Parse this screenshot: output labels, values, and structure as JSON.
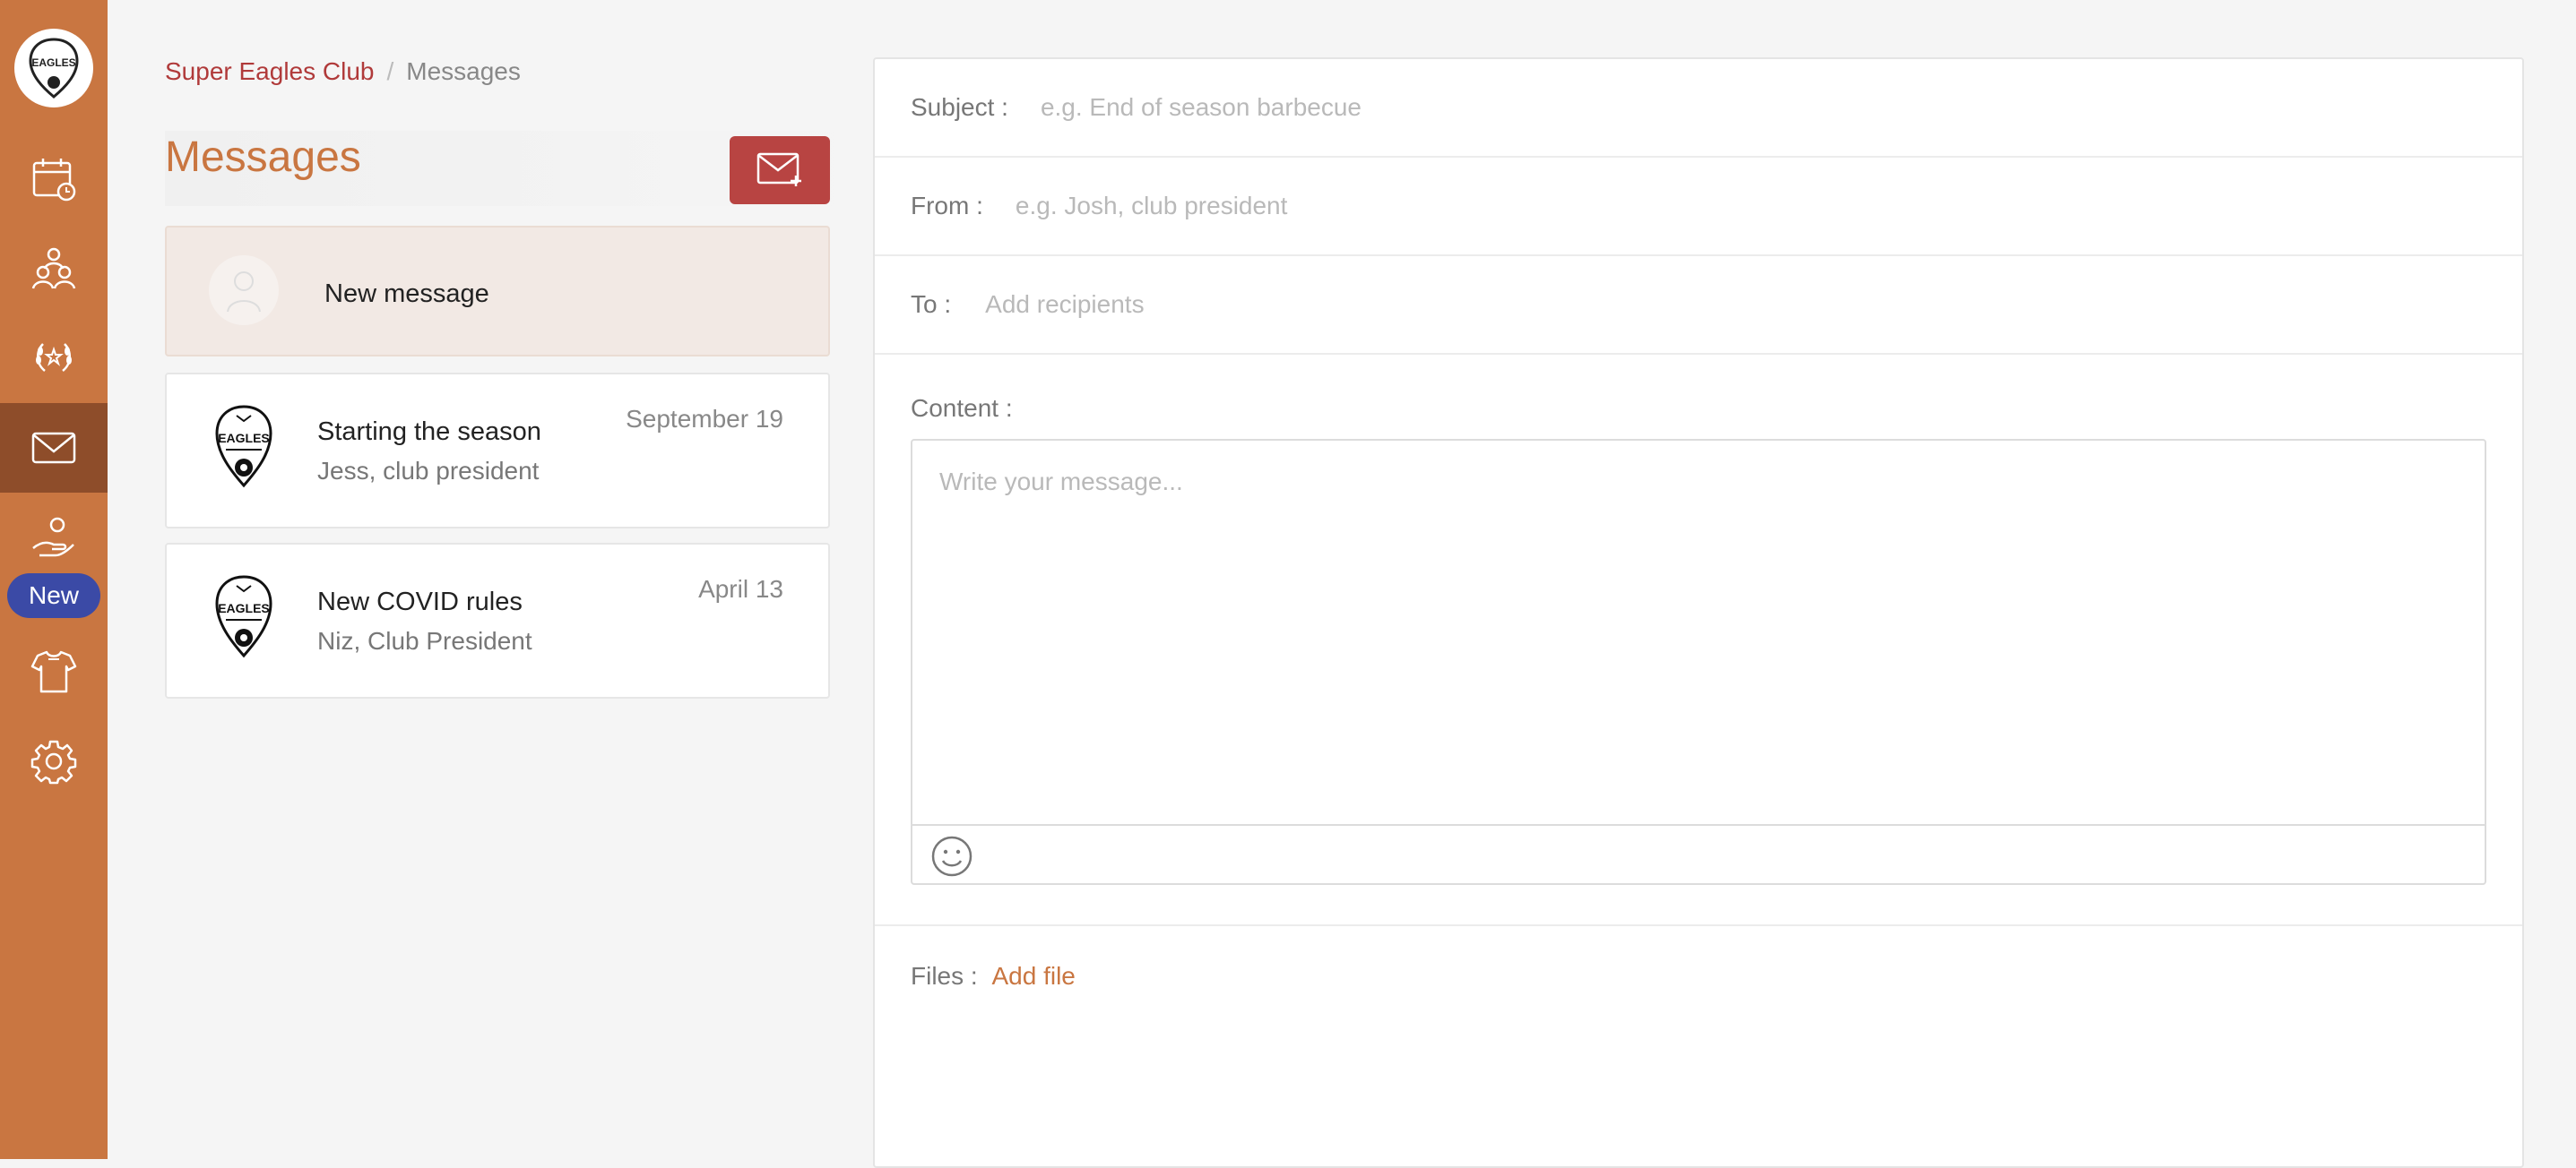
{
  "sidebar": {
    "logo_icon": "club-crest-logo",
    "new_badge": "New",
    "items": [
      {
        "name": "calendar-icon",
        "active": false
      },
      {
        "name": "members-icon",
        "active": false
      },
      {
        "name": "laurel-trophy-icon",
        "active": false
      },
      {
        "name": "envelope-icon",
        "active": true
      },
      {
        "name": "hand-donation-icon",
        "active": false
      },
      {
        "name": "jersey-icon",
        "active": false
      },
      {
        "name": "gear-icon",
        "active": false
      }
    ]
  },
  "breadcrumb": {
    "club": "Super Eagles Club",
    "separator": "/",
    "current": "Messages"
  },
  "page": {
    "title": "Messages",
    "compose_icon": "envelope-plus-icon"
  },
  "messages": [
    {
      "subject": "New message",
      "sender": "",
      "date": "",
      "selected": true,
      "avatar": "placeholder-person-icon"
    },
    {
      "subject": "Starting the season",
      "sender": "Jess, club president",
      "date": "September 19",
      "selected": false,
      "avatar": "club-crest-icon"
    },
    {
      "subject": "New COVID rules",
      "sender": "Niz, Club President",
      "date": "April 13",
      "selected": false,
      "avatar": "club-crest-icon"
    }
  ],
  "form": {
    "subject_label": "Subject :",
    "subject_placeholder": "e.g. End of season barbecue",
    "from_label": "From :",
    "from_placeholder": "e.g. Josh, club president",
    "to_label": "To :",
    "to_placeholder": "Add recipients",
    "content_label": "Content :",
    "content_placeholder": "Write your message...",
    "emoji_icon": "smiley-icon",
    "files_label": "Files :",
    "add_file": "Add file"
  },
  "colors": {
    "sidebar": "#c97641",
    "sidebar_active": "#8e4d2a",
    "accent": "#c97641",
    "compose_button": "#b84442",
    "badge": "#3b4aa6"
  }
}
